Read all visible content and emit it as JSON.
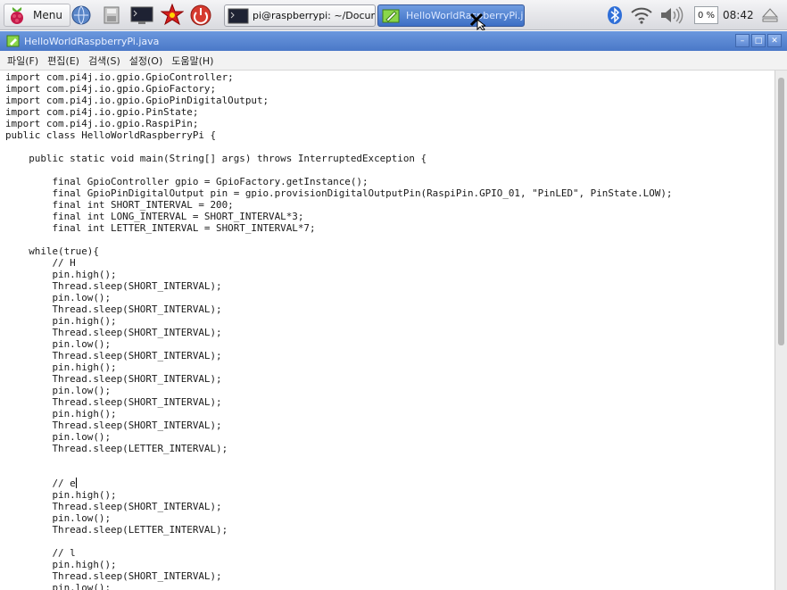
{
  "taskbar": {
    "menu_label": "Menu",
    "tasks": [
      {
        "label": "pi@raspberrypi: ~/Docume..."
      },
      {
        "label": "HelloWorldRaspberryPi.java"
      }
    ],
    "cpu_label": "0 %",
    "clock": "08:42",
    "accent": "#4a78c8"
  },
  "window": {
    "title": "HelloWorldRaspberryPi.java"
  },
  "menubar": {
    "items": [
      "파일(F)",
      "편집(E)",
      "검색(S)",
      "설정(O)",
      "도움말(H)"
    ]
  },
  "editor": {
    "lines": [
      "import com.pi4j.io.gpio.GpioController;",
      "import com.pi4j.io.gpio.GpioFactory;",
      "import com.pi4j.io.gpio.GpioPinDigitalOutput;",
      "import com.pi4j.io.gpio.PinState;",
      "import com.pi4j.io.gpio.RaspiPin;",
      "public class HelloWorldRaspberryPi {",
      "",
      "    public static void main(String[] args) throws InterruptedException {",
      "",
      "        final GpioController gpio = GpioFactory.getInstance();",
      "        final GpioPinDigitalOutput pin = gpio.provisionDigitalOutputPin(RaspiPin.GPIO_01, \"PinLED\", PinState.LOW);",
      "        final int SHORT_INTERVAL = 200;",
      "        final int LONG_INTERVAL = SHORT_INTERVAL*3;",
      "        final int LETTER_INTERVAL = SHORT_INTERVAL*7;",
      "",
      "    while(true){",
      "        // H",
      "        pin.high();",
      "        Thread.sleep(SHORT_INTERVAL);",
      "        pin.low();",
      "        Thread.sleep(SHORT_INTERVAL);",
      "        pin.high();",
      "        Thread.sleep(SHORT_INTERVAL);",
      "        pin.low();",
      "        Thread.sleep(SHORT_INTERVAL);",
      "        pin.high();",
      "        Thread.sleep(SHORT_INTERVAL);",
      "        pin.low();",
      "        Thread.sleep(SHORT_INTERVAL);",
      "        pin.high();",
      "        Thread.sleep(SHORT_INTERVAL);",
      "        pin.low();",
      "        Thread.sleep(LETTER_INTERVAL);",
      "",
      "",
      "        // e",
      "        pin.high();",
      "        Thread.sleep(SHORT_INTERVAL);",
      "        pin.low();",
      "        Thread.sleep(LETTER_INTERVAL);",
      "",
      "        // l",
      "        pin.high();",
      "        Thread.sleep(SHORT_INTERVAL);",
      "        pin.low();"
    ],
    "cursor_line": 35
  }
}
